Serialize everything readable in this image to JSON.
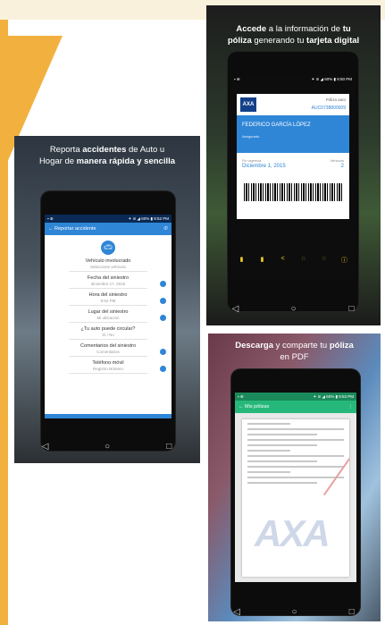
{
  "colors": {
    "accent_orange": "#f2b13f",
    "header_blue": "#2f86d6",
    "status_navy": "#0a2a55",
    "pdf_green": "#26b87a",
    "axa_blue": "#13408a",
    "axa_red": "#e03a3a",
    "tool_yellow": "#f2d027"
  },
  "panel_report": {
    "heading_plain_1": "Reporta ",
    "heading_bold_1": "accidentes",
    "heading_plain_2": " de Auto u",
    "heading_plain_3": "Hogar de ",
    "heading_bold_2": "manera rápida y sencilla",
    "status_left": "▪ ⊕",
    "status_right": "✦ ⊘ ◢ 60% ▮ 8:52 PM",
    "app_title": "← Reportar accidente",
    "call_icon": "phone-icon",
    "car_icon": "car-icon",
    "fields": [
      {
        "label": "Vehículo involucrado",
        "value": "Seleccione vehículo"
      },
      {
        "label": "Fecha del siniestro",
        "value": "diciembre 17, 2015"
      },
      {
        "label": "Hora del siniestro",
        "value": "8:52 PM"
      },
      {
        "label": "Lugar del siniestro",
        "value": "Mi ubicación"
      },
      {
        "label": "¿Tu auto puede circular?",
        "value": "Sí / No"
      },
      {
        "label": "Comentarios del siniestro",
        "value": "Comentarios"
      },
      {
        "label": "Teléfono móvil",
        "value": "Registro Número"
      }
    ],
    "nav": [
      "◁",
      "○",
      "□"
    ]
  },
  "panel_card": {
    "heading_plain_1": "Accede",
    "heading_plain_2": " a la información de ",
    "heading_bold_1": "tu",
    "heading_bold_2": "póliza",
    "heading_plain_3": " generando tu ",
    "heading_bold_3": "tarjeta digital",
    "status_left": "▪ ⊕",
    "status_right": "✦ ⊘ ◢ 60% ▮ 8:50 PM",
    "logo_text": "AXA",
    "card_type": "Póliza auto",
    "card_number": "AUC0738800009",
    "holder_name": "FEDERICO GARCÍA LÓPEZ",
    "holder_role": "Asegurado",
    "vigencia_label": "Fin vigencia",
    "vigencia_date": "Diciembre 1, 2015",
    "vehiculo_label": "Vehículo",
    "vehiculo_num": "2",
    "tools": [
      "▮",
      "▮",
      "<",
      "◌",
      "◌",
      "ⓘ"
    ],
    "nav": [
      "◁",
      "○",
      "□"
    ]
  },
  "panel_pdf": {
    "heading_bold_1": "Descarga",
    "heading_plain_1": " y comparte tu ",
    "heading_bold_2": "póliza",
    "heading_plain_2": "en PDF",
    "status_left": "▪ ⊕",
    "status_right": "✦ ⊘ ◢ 60% ▮ 8:53 PM",
    "app_title": "← Mis pólizas",
    "app_action": "⋮",
    "pdf_logo": "AXA",
    "nav": [
      "◁",
      "○",
      "□"
    ]
  }
}
